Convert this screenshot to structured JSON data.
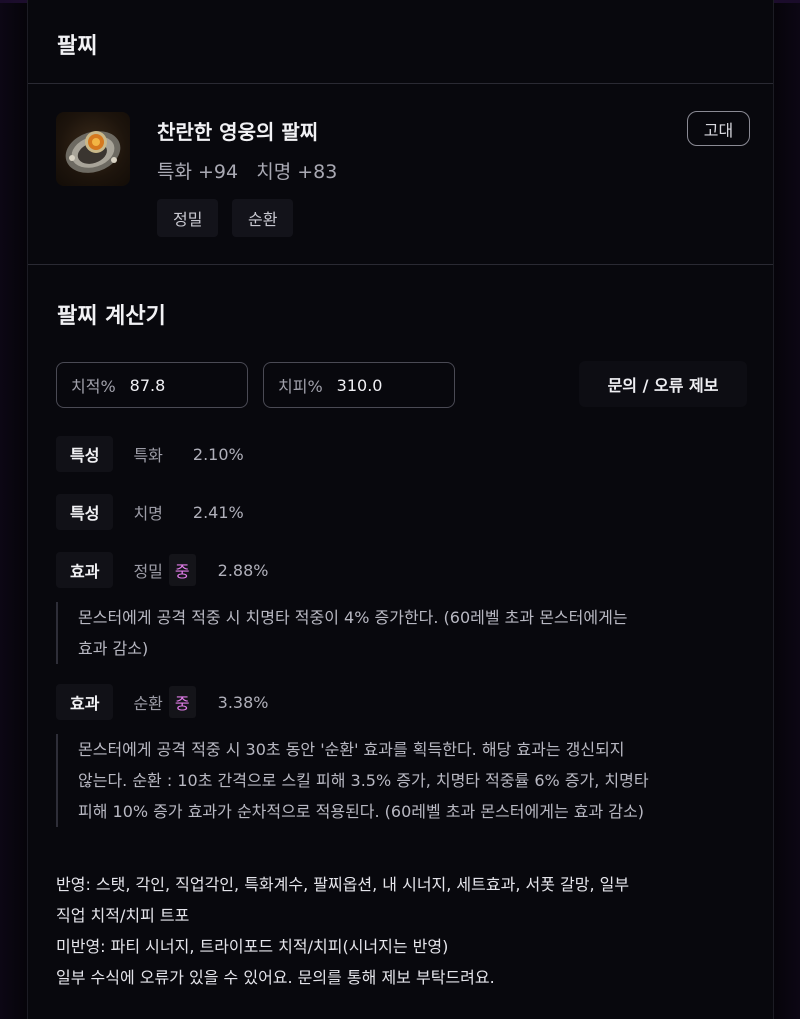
{
  "header": {
    "title": "팔찌"
  },
  "item": {
    "name": "찬란한 영웅의 팔찌",
    "stats": "특화 +94   치명 +83",
    "grade": "고대",
    "engravings": [
      "정밀",
      "순환"
    ],
    "icon": "bracelet-icon"
  },
  "calculator": {
    "title": "팔찌 계산기",
    "crit_rate": {
      "label": "치적%",
      "value": "87.8"
    },
    "crit_damage": {
      "label": "치피%",
      "value": "310.0"
    },
    "report_button": "문의 / 오류 제보",
    "rows": [
      {
        "tag": "특성",
        "name": "특화",
        "level": "",
        "pct": "2.10%"
      },
      {
        "tag": "특성",
        "name": "치명",
        "level": "",
        "pct": "2.41%"
      },
      {
        "tag": "효과",
        "name": "정밀",
        "level": "중",
        "pct": "2.88%",
        "desc": [
          "몬스터에게 공격 적중 시 치명타 적중이 4% 증가한다. (60레벨 초과 몬스터에게는",
          "효과 감소)"
        ]
      },
      {
        "tag": "효과",
        "name": "순환",
        "level": "중",
        "pct": "3.38%",
        "desc": [
          "몬스터에게 공격 적중 시 30초 동안 '순환' 효과를 획득한다. 해당 효과는 갱신되지",
          "않는다. 순환 : 10초 간격으로 스킬 피해 3.5% 증가, 치명타 적중률 6% 증가, 치명타",
          "피해 10% 증가 효과가 순차적으로 적용된다. (60레벨 초과 몬스터에게는 효과 감소)"
        ]
      }
    ]
  },
  "footer": [
    "반영: 스탯, 각인, 직업각인, 특화계수, 팔찌옵션, 내 시너지, 세트효과, 서폿 갈망, 일부",
    "직업 치적/치피 트포",
    "미반영: 파티 시너지, 트라이포드 치적/치피(시너지는 반영)",
    "일부 수식에 오류가 있을 수 있어요. 문의를 통해 제보 부탁드려요."
  ]
}
